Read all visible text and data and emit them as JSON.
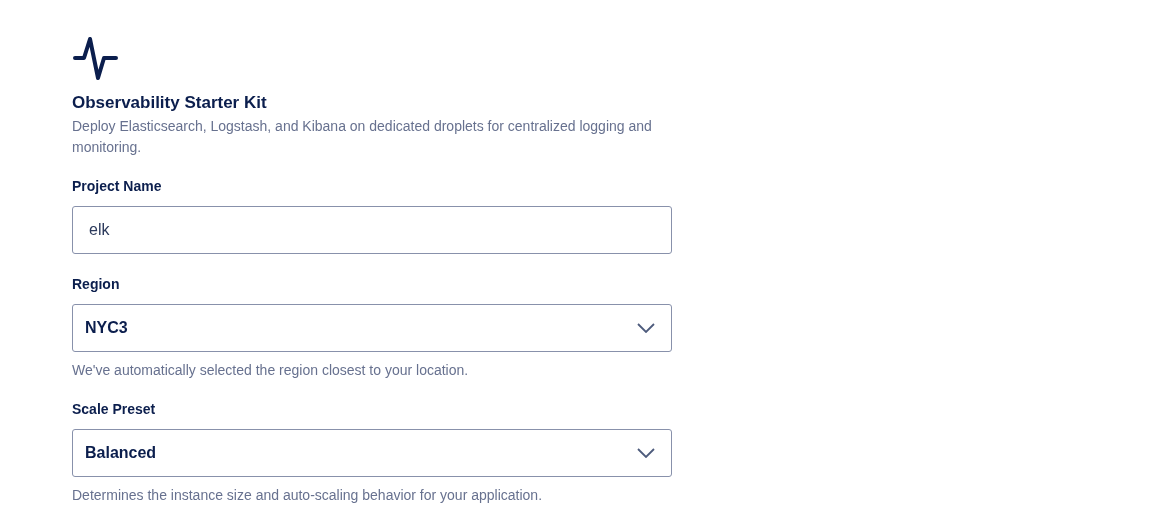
{
  "title": "Observability Starter Kit",
  "description": "Deploy Elasticsearch, Logstash, and Kibana on dedicated droplets for centralized logging and monitoring.",
  "fields": [
    {
      "kind": "text",
      "label": "Project Name",
      "value": "elk"
    },
    {
      "kind": "select",
      "label": "Region",
      "value": "NYC3",
      "hint": "We've automatically selected the region closest to your location."
    },
    {
      "kind": "select",
      "label": "Scale Preset",
      "value": "Balanced",
      "hint": "Determines the instance size and auto-scaling behavior for your application."
    }
  ]
}
